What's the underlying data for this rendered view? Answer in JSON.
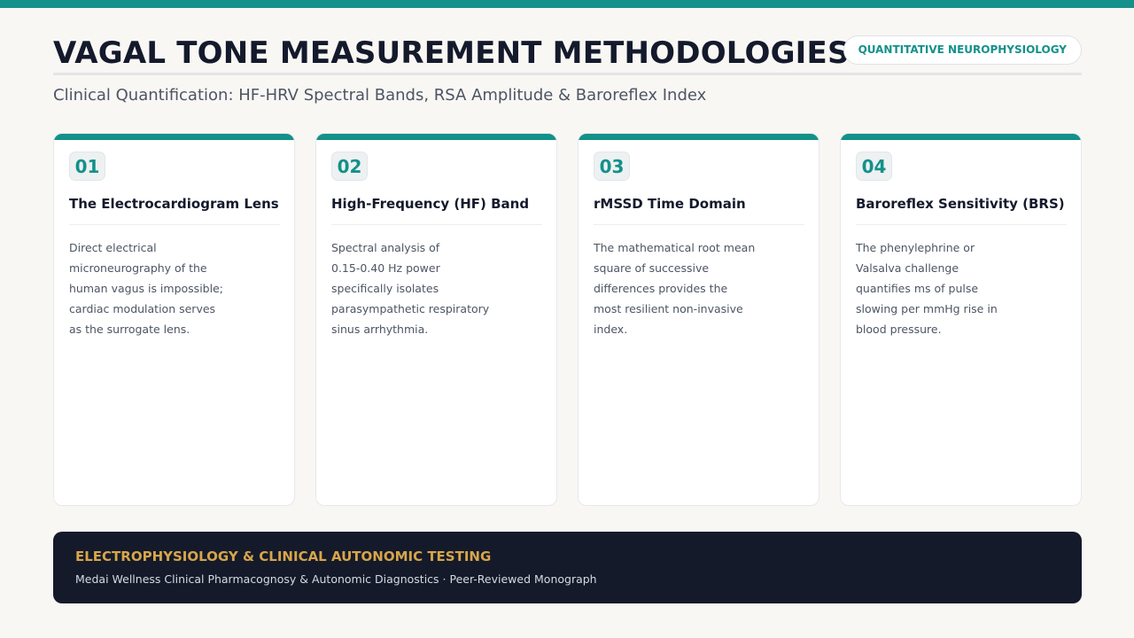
{
  "header": {
    "title": "VAGAL TONE MEASUREMENT METHODOLOGIES",
    "badge": "QUANTITATIVE NEUROPHYSIOLOGY",
    "subtitle": "Clinical Quantification: HF-HRV Spectral Bands, RSA Amplitude & Baroreflex Index"
  },
  "cards": [
    {
      "number": "01",
      "title": "The Electrocardiogram Lens",
      "body_lines": [
        "Direct electrical",
        "microneurography of the",
        "human vagus is impossible;",
        "cardiac modulation serves",
        "as the surrogate lens."
      ]
    },
    {
      "number": "02",
      "title": "High-Frequency (HF) Band",
      "body_lines": [
        "Spectral analysis of",
        "0.15-0.40 Hz power",
        "specifically isolates",
        "parasympathetic respiratory",
        "sinus arrhythmia."
      ]
    },
    {
      "number": "03",
      "title": "rMSSD Time Domain",
      "body_lines": [
        "The mathematical root mean",
        "square of successive",
        "differences provides the",
        "most resilient non-invasive",
        "index."
      ]
    },
    {
      "number": "04",
      "title": "Baroreflex Sensitivity (BRS)",
      "body_lines": [
        "The phenylephrine or",
        "Valsalva challenge",
        "quantifies ms of pulse",
        "slowing per mmHg rise in",
        "blood pressure."
      ]
    }
  ],
  "footer": {
    "title": "ELECTROPHYSIOLOGY & CLINICAL AUTONOMIC TESTING",
    "subtitle": "Medai Wellness Clinical Pharmacognosy & Autonomic Diagnostics · Peer-Reviewed Monograph"
  },
  "colors": {
    "accent": "#13918a",
    "title": "#141a2c",
    "footer_bg": "#141a2a",
    "footer_title": "#d8a54a",
    "background": "#f8f7f4"
  }
}
